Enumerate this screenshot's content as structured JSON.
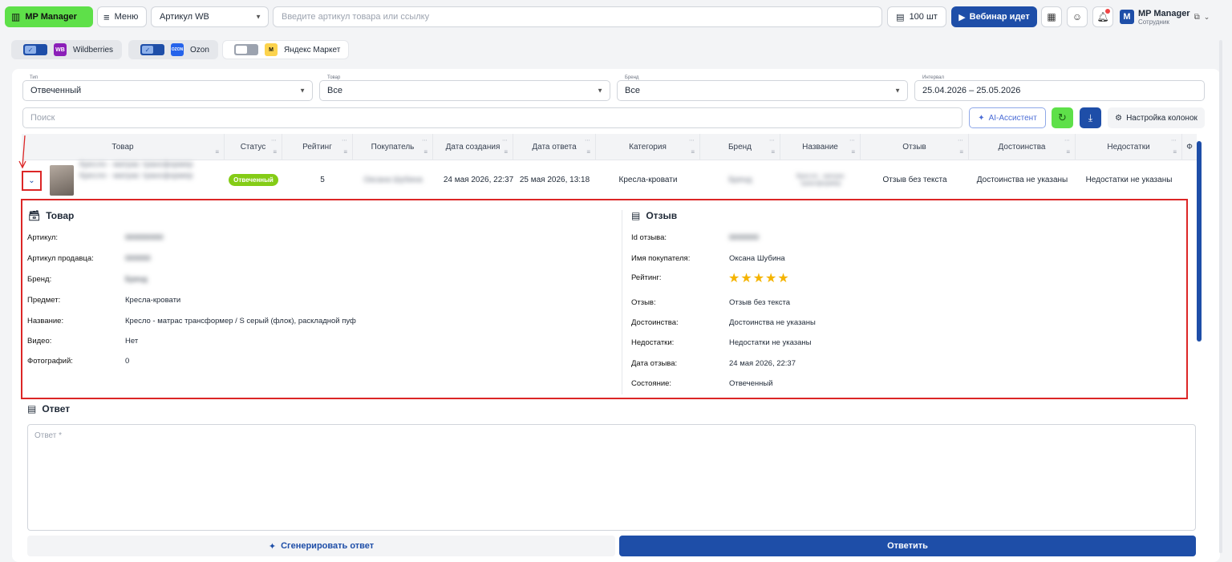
{
  "topbar": {
    "logo": "MP Manager",
    "menu": "Меню",
    "article_select": "Артикул WB",
    "search_placeholder": "Введите артикул товара или ссылку",
    "count": "100 шт",
    "webinar": "Вебинар идет",
    "user_name": "MP Manager",
    "user_role": "Сотрудник",
    "avatar_letter": "M"
  },
  "marketplaces": [
    {
      "name": "Wildberries",
      "enabled": true,
      "logo_text": "WB",
      "color": "#8b1fb8"
    },
    {
      "name": "Ozon",
      "enabled": true,
      "logo_text": "OZON",
      "color": "#2563eb"
    },
    {
      "name": "Яндекс Маркет",
      "enabled": false,
      "logo_text": "M",
      "color": "#fcd34d"
    }
  ],
  "filters": {
    "type": {
      "label": "Тип",
      "value": "Отвеченный"
    },
    "product": {
      "label": "Товар",
      "value": "Все"
    },
    "brand": {
      "label": "Бренд",
      "value": "Все"
    },
    "interval": {
      "label": "Интервал",
      "value": "25.04.2026 – 25.05.2026"
    }
  },
  "search_placeholder": "Поиск",
  "ai_button": "AI-Ассистент",
  "columns_button": "Настройка колонок",
  "table": {
    "headers": [
      "Товар",
      "Статус",
      "Рейтинг",
      "Покупатель",
      "Дата создания",
      "Дата ответа",
      "Категория",
      "Бренд",
      "Название",
      "Отзыв",
      "Достоинства",
      "Недостатки",
      "Ф"
    ],
    "row": {
      "product": "Кресло - матрас трансформер",
      "status": "Отвеченный",
      "rating": "5",
      "buyer": "Оксана Шубина",
      "created": "24 мая 2026, 22:37",
      "answered": "25 мая 2026, 13:18",
      "category": "Кресла-кровати",
      "brand": "Бренд",
      "name": "Кресло - матрас трансформер",
      "review": "Отзыв без текста",
      "pros": "Достоинства не указаны",
      "cons": "Недостатки не указаны"
    }
  },
  "detail": {
    "product_title": "Товар",
    "product_fields": [
      {
        "label": "Артикул:",
        "value": "000000000"
      },
      {
        "label": "Артикул продавца:",
        "value": "000000"
      },
      {
        "label": "Бренд:",
        "value": "Бренд"
      },
      {
        "label": "Предмет:",
        "value": "Кресла-кровати"
      },
      {
        "label": "Название:",
        "value": "Кресло - матрас трансформер / S серый (флок), раскладной пуф"
      },
      {
        "label": "Видео:",
        "value": "Нет"
      },
      {
        "label": "Фотографий:",
        "value": "0"
      }
    ],
    "review_title": "Отзыв",
    "review_fields": [
      {
        "label": "Id отзыва:",
        "value": "0000000"
      },
      {
        "label": "Имя покупателя:",
        "value": "Оксана Шубина"
      },
      {
        "label": "Рейтинг:",
        "value": "★★★★★"
      },
      {
        "label": "Отзыв:",
        "value": "Отзыв без текста"
      },
      {
        "label": "Достоинства:",
        "value": "Достоинства не указаны"
      },
      {
        "label": "Недостатки:",
        "value": "Недостатки не указаны"
      },
      {
        "label": "Дата отзыва:",
        "value": "24 мая 2026, 22:37"
      },
      {
        "label": "Состояние:",
        "value": "Отвеченный"
      }
    ]
  },
  "answer": {
    "title": "Ответ",
    "placeholder": "Ответ *",
    "generate": "Сгенерировать ответ",
    "reply": "Ответить"
  }
}
